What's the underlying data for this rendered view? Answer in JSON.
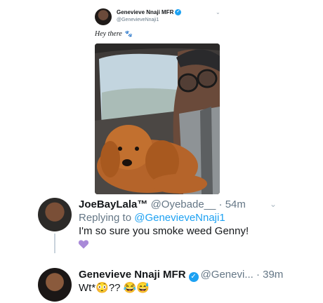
{
  "original_tweet": {
    "author_name": "Genevieve Nnaji MFR",
    "handle": "@GenevieveNnaji1",
    "text": "Hey there",
    "emoji": "🐾",
    "verified_glyph": "✓",
    "chevron": "⌄"
  },
  "reply_1": {
    "author_name": "JoeBayLala™",
    "handle": "@Oyebade__",
    "separator": "·",
    "time": "54m",
    "replying_prefix": "Replying to",
    "replying_to": "@GenevieveNnaji1",
    "text": "I'm so sure you smoke weed Genny!",
    "like_icon": "purple-heart-icon",
    "chevron": "⌄"
  },
  "reply_2": {
    "author_name": "Genevieve Nnaji MFR",
    "verified_glyph": "✓",
    "handle": "@Genevi...",
    "separator": "·",
    "time": "39m",
    "text": "Wt*😳?? 😂😅",
    "chevron": "⌄"
  },
  "colors": {
    "accent": "#1da1f2",
    "secondary_text": "#657786",
    "heart": "#a98ad8"
  }
}
